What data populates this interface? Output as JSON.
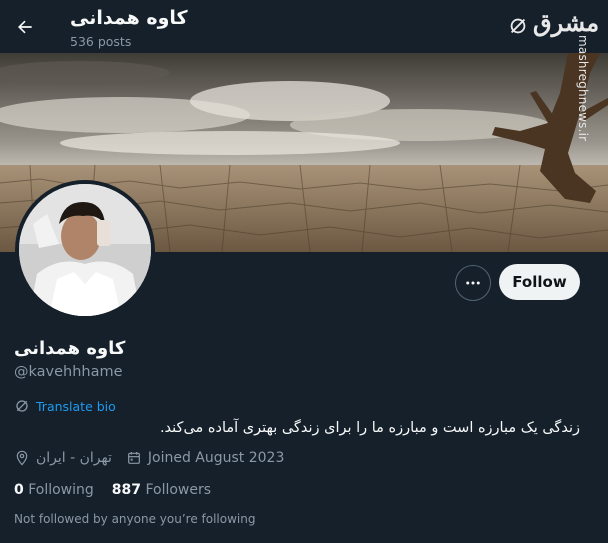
{
  "header": {
    "title": "کاوه همدانی",
    "post_count": "536 posts"
  },
  "watermark": {
    "logo": "مشرق",
    "site": "mashreghnews.ir"
  },
  "profile": {
    "display_name": "کاوه همدانی",
    "handle": "@kavehhhame",
    "translate_label": "Translate bio",
    "bio": "زندگی یک مبارزه است و مبارزه ما را برای زندگی بهتری آماده می‌کند.",
    "location": "تهران - ایران",
    "joined": "Joined August 2023",
    "following_count": "0",
    "following_label": "Following",
    "followers_count": "887",
    "followers_label": "Followers",
    "not_followed_text": "Not followed by anyone you’re following"
  },
  "actions": {
    "follow_label": "Follow"
  },
  "icons": {
    "back": "arrow-left-icon",
    "more": "more-options-icon",
    "translate": "translate-icon",
    "location": "location-pin-icon",
    "calendar": "calendar-icon"
  },
  "colors": {
    "background": "#15202b",
    "accent": "#1d9bf0",
    "muted_text": "#8b98a5",
    "follow_button": "#eff3f4"
  }
}
